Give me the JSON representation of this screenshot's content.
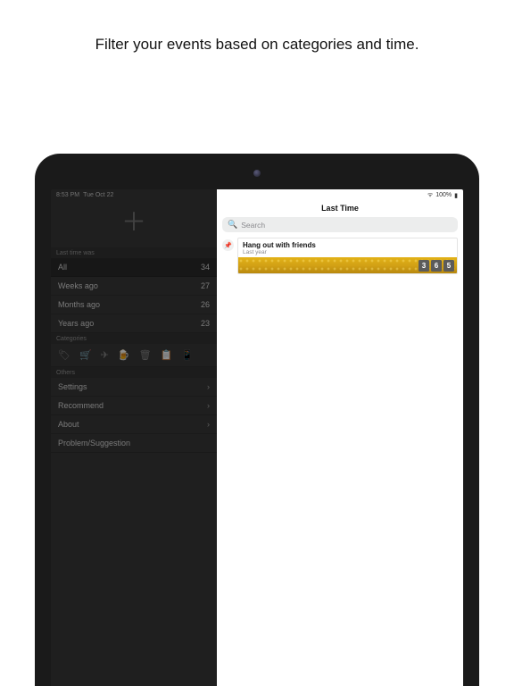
{
  "caption": "Filter your events based on categories and time.",
  "status": {
    "time": "8:53 PM",
    "date": "Tue Oct 22",
    "battery_pct": "100%",
    "wifi_glyph": "ᯤ",
    "battery_glyph": "▮"
  },
  "sidebar": {
    "add_label": "＋",
    "sections": {
      "last_time_was": {
        "header": "Last time was",
        "items": [
          {
            "label": "All",
            "count": "34",
            "selected": true
          },
          {
            "label": "Weeks ago",
            "count": "27",
            "selected": false
          },
          {
            "label": "Months ago",
            "count": "26",
            "selected": false
          },
          {
            "label": "Years ago",
            "count": "23",
            "selected": false
          }
        ]
      },
      "categories": {
        "header": "Categories",
        "icons": [
          {
            "glyph": "🏷",
            "name": "tag-icon"
          },
          {
            "glyph": "🛒",
            "name": "cart-icon"
          },
          {
            "glyph": "✈",
            "name": "plane-icon"
          },
          {
            "glyph": "🍺",
            "name": "beer-icon",
            "active": true
          },
          {
            "glyph": "🗑",
            "name": "trash-icon"
          },
          {
            "glyph": "📋",
            "name": "clipboard-icon"
          },
          {
            "glyph": "📱",
            "name": "phone-icon"
          }
        ]
      },
      "others": {
        "header": "Others",
        "items": [
          {
            "label": "Settings",
            "chevron": true
          },
          {
            "label": "Recommend",
            "chevron": true
          },
          {
            "label": "About",
            "chevron": true
          },
          {
            "label": "Problem/Suggestion",
            "chevron": false
          }
        ]
      }
    }
  },
  "main": {
    "title": "Last Time",
    "search_placeholder": "Search",
    "event": {
      "pin_glyph": "📌",
      "title": "Hang out with friends",
      "subtitle": "Last year",
      "digits": [
        "3",
        "6",
        "5"
      ]
    }
  }
}
